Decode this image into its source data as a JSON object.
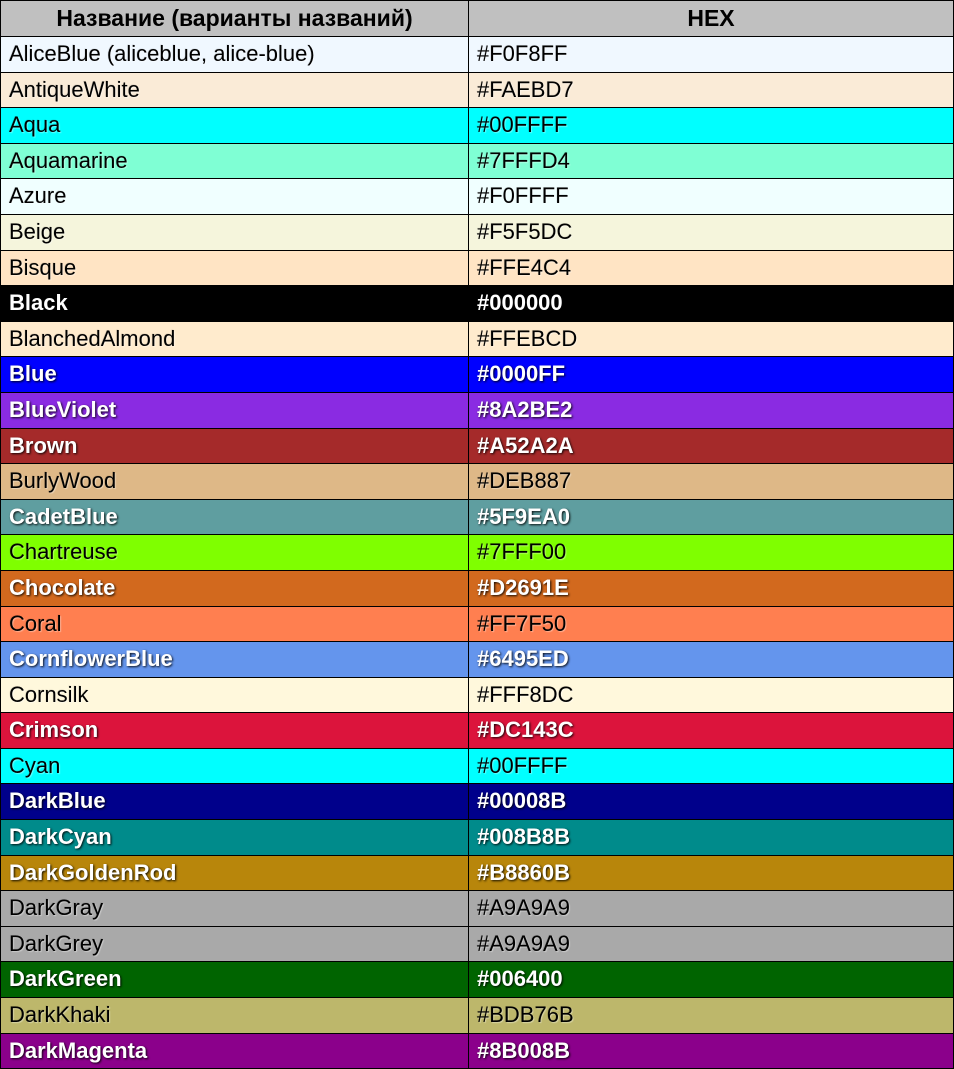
{
  "headers": {
    "name": "Название (варианты названий)",
    "hex": "HEX"
  },
  "rows": [
    {
      "name": "AliceBlue (aliceblue, alice-blue)",
      "hex": "#F0F8FF",
      "bg": "#F0F8FF",
      "light": false
    },
    {
      "name": "AntiqueWhite",
      "hex": "#FAEBD7",
      "bg": "#FAEBD7",
      "light": false
    },
    {
      "name": "Aqua",
      "hex": "#00FFFF",
      "bg": "#00FFFF",
      "light": false
    },
    {
      "name": "Aquamarine",
      "hex": "#7FFFD4",
      "bg": "#7FFFD4",
      "light": false
    },
    {
      "name": "Azure",
      "hex": "#F0FFFF",
      "bg": "#F0FFFF",
      "light": false
    },
    {
      "name": "Beige",
      "hex": "#F5F5DC",
      "bg": "#F5F5DC",
      "light": false
    },
    {
      "name": "Bisque",
      "hex": "#FFE4C4",
      "bg": "#FFE4C4",
      "light": false
    },
    {
      "name": "Black",
      "hex": "#000000",
      "bg": "#000000",
      "light": true
    },
    {
      "name": "BlanchedAlmond",
      "hex": "#FFEBCD",
      "bg": "#FFEBCD",
      "light": false
    },
    {
      "name": "Blue",
      "hex": "#0000FF",
      "bg": "#0000FF",
      "light": true
    },
    {
      "name": "BlueViolet",
      "hex": "#8A2BE2",
      "bg": "#8A2BE2",
      "light": true
    },
    {
      "name": "Brown",
      "hex": "#A52A2A",
      "bg": "#A52A2A",
      "light": true
    },
    {
      "name": "BurlyWood",
      "hex": "#DEB887",
      "bg": "#DEB887",
      "light": false
    },
    {
      "name": "CadetBlue",
      "hex": "#5F9EA0",
      "bg": "#5F9EA0",
      "light": true
    },
    {
      "name": "Chartreuse",
      "hex": "#7FFF00",
      "bg": "#7FFF00",
      "light": false
    },
    {
      "name": "Chocolate",
      "hex": "#D2691E",
      "bg": "#D2691E",
      "light": true
    },
    {
      "name": "Coral",
      "hex": "#FF7F50",
      "bg": "#FF7F50",
      "light": false
    },
    {
      "name": "CornflowerBlue",
      "hex": "#6495ED",
      "bg": "#6495ED",
      "light": true
    },
    {
      "name": "Cornsilk",
      "hex": "#FFF8DC",
      "bg": "#FFF8DC",
      "light": false
    },
    {
      "name": "Crimson",
      "hex": "#DC143C",
      "bg": "#DC143C",
      "light": true
    },
    {
      "name": "Cyan",
      "hex": "#00FFFF",
      "bg": "#00FFFF",
      "light": false
    },
    {
      "name": "DarkBlue",
      "hex": "#00008B",
      "bg": "#00008B",
      "light": true
    },
    {
      "name": "DarkCyan",
      "hex": "#008B8B",
      "bg": "#008B8B",
      "light": true
    },
    {
      "name": "DarkGoldenRod",
      "hex": "#B8860B",
      "bg": "#B8860B",
      "light": true
    },
    {
      "name": "DarkGray",
      "hex": "#A9A9A9",
      "bg": "#A9A9A9",
      "light": false
    },
    {
      "name": "DarkGrey",
      "hex": "#A9A9A9",
      "bg": "#A9A9A9",
      "light": false
    },
    {
      "name": "DarkGreen",
      "hex": "#006400",
      "bg": "#006400",
      "light": true
    },
    {
      "name": "DarkKhaki",
      "hex": "#BDB76B",
      "bg": "#BDB76B",
      "light": false
    },
    {
      "name": "DarkMagenta",
      "hex": "#8B008B",
      "bg": "#8B008B",
      "light": true
    }
  ]
}
